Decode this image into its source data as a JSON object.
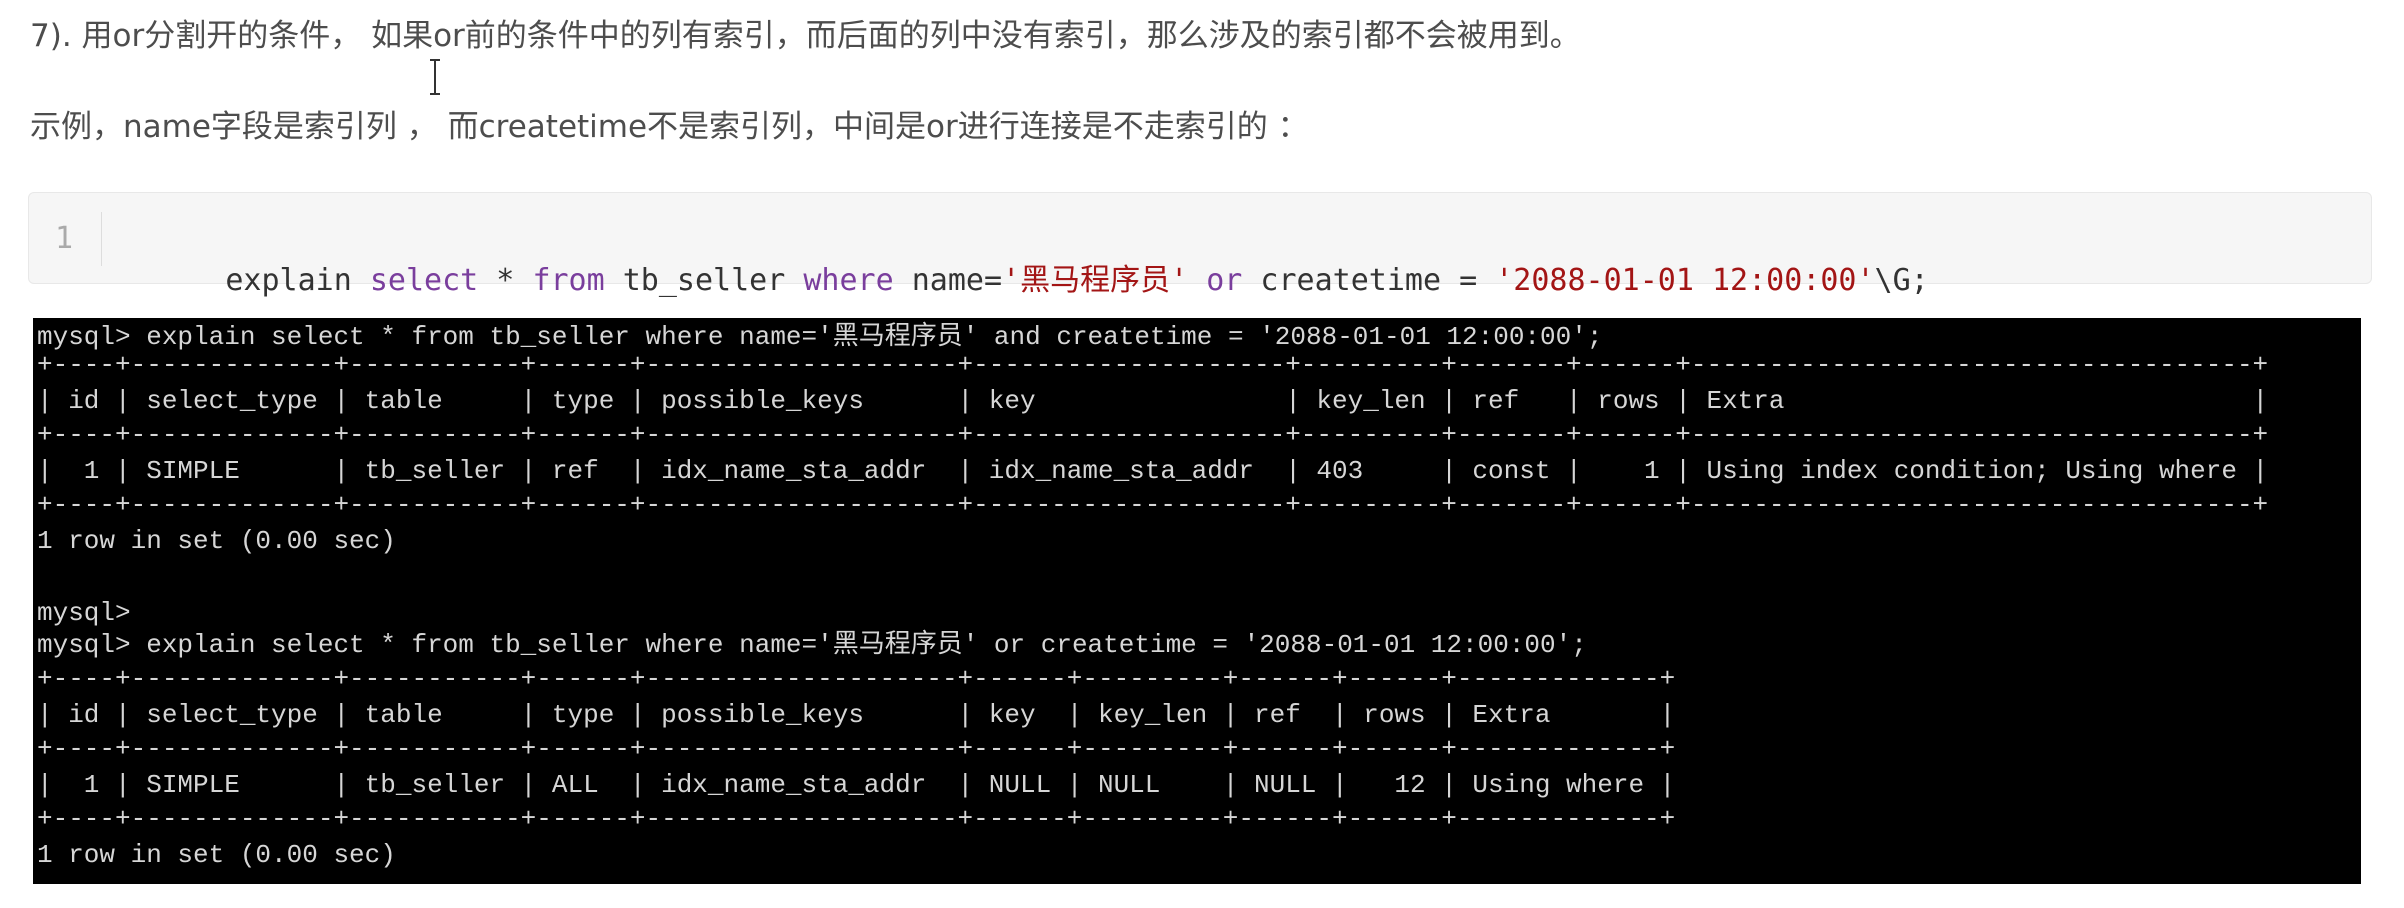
{
  "paragraphs": {
    "p1": "7). 用or分割开的条件， 如果or前的条件中的列有索引，而后面的列中没有索引，那么涉及的索引都不会被用到。",
    "p2": "示例，name字段是索引列 ， 而createtime不是索引列，中间是or进行连接是不走索引的 ："
  },
  "code_block": {
    "line_number": "1",
    "tokens": [
      {
        "text": "explain ",
        "type": "plain"
      },
      {
        "text": "select",
        "type": "kw"
      },
      {
        "text": " * ",
        "type": "plain"
      },
      {
        "text": "from",
        "type": "kw"
      },
      {
        "text": " tb_seller ",
        "type": "plain"
      },
      {
        "text": "where",
        "type": "kw"
      },
      {
        "text": " name=",
        "type": "plain"
      },
      {
        "text": "'黑马程序员'",
        "type": "str"
      },
      {
        "text": " ",
        "type": "plain"
      },
      {
        "text": "or",
        "type": "kw"
      },
      {
        "text": " createtime = ",
        "type": "plain"
      },
      {
        "text": "'2088-01-01 12:00:00'",
        "type": "str"
      },
      {
        "text": "\\G;",
        "type": "plain"
      }
    ]
  },
  "terminal": {
    "lines": [
      "mysql> explain select * from tb_seller where name='黑马程序员' and createtime = '2088-01-01 12:00:00';",
      "+----+-------------+-----------+------+--------------------+--------------------+---------+-------+------+------------------------------------+",
      "| id | select_type | table     | type | possible_keys      | key                | key_len | ref   | rows | Extra                              |",
      "+----+-------------+-----------+------+--------------------+--------------------+---------+-------+------+------------------------------------+",
      "|  1 | SIMPLE      | tb_seller | ref  | idx_name_sta_addr  | idx_name_sta_addr  | 403     | const |    1 | Using index condition; Using where |",
      "+----+-------------+-----------+------+--------------------+--------------------+---------+-------+------+------------------------------------+",
      "1 row in set (0.00 sec)",
      "",
      "mysql>",
      "mysql> explain select * from tb_seller where name='黑马程序员' or createtime = '2088-01-01 12:00:00';",
      "+----+-------------+-----------+------+--------------------+------+---------+------+------+-------------+",
      "| id | select_type | table     | type | possible_keys      | key  | key_len | ref  | rows | Extra       |",
      "+----+-------------+-----------+------+--------------------+------+---------+------+------+-------------+",
      "|  1 | SIMPLE      | tb_seller | ALL  | idx_name_sta_addr  | NULL | NULL    | NULL |   12 | Using where |",
      "+----+-------------+-----------+------+--------------------+------+---------+------+------+-------------+",
      "1 row in set (0.00 sec)"
    ]
  },
  "colors": {
    "keyword": "#7a3e9d",
    "string": "#a31515",
    "terminal_bg": "#000000",
    "terminal_fg": "#d6d6d6"
  }
}
